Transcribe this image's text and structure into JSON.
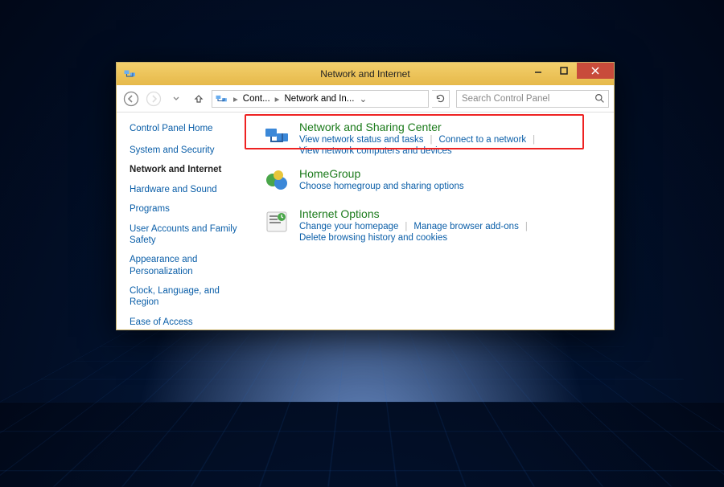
{
  "window": {
    "title": "Network and Internet"
  },
  "breadcrumb": {
    "segs": [
      "Cont...",
      "Network and In..."
    ]
  },
  "search": {
    "placeholder": "Search Control Panel"
  },
  "sidebar": {
    "home": "Control Panel Home",
    "items": [
      {
        "label": "System and Security",
        "active": false
      },
      {
        "label": "Network and Internet",
        "active": true
      },
      {
        "label": "Hardware and Sound",
        "active": false
      },
      {
        "label": "Programs",
        "active": false
      },
      {
        "label": "User Accounts and Family Safety",
        "active": false
      },
      {
        "label": "Appearance and Personalization",
        "active": false
      },
      {
        "label": "Clock, Language, and Region",
        "active": false
      },
      {
        "label": "Ease of Access",
        "active": false
      }
    ]
  },
  "main": {
    "cats": [
      {
        "title": "Network and Sharing Center",
        "subs": [
          "View network status and tasks",
          "Connect to a network",
          "View network computers and devices"
        ]
      },
      {
        "title": "HomeGroup",
        "subs": [
          "Choose homegroup and sharing options"
        ]
      },
      {
        "title": "Internet Options",
        "subs": [
          "Change your homepage",
          "Manage browser add-ons",
          "Delete browsing history and cookies"
        ]
      }
    ]
  }
}
